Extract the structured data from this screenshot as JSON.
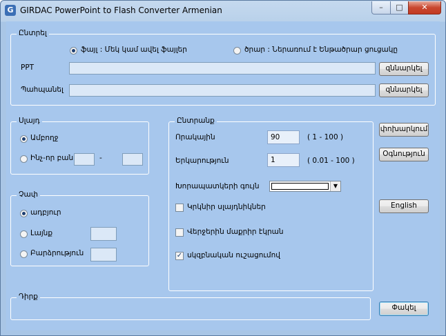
{
  "window": {
    "title": "GIRDAC PowerPoint to Flash Converter Armenian",
    "icon": "app-logo-icon",
    "controls": {
      "minimize": "–",
      "maximize": "□",
      "close": "✕"
    }
  },
  "select_group": {
    "label": "Ընտրել",
    "radio_file": "ֆայլ :  Մեկ կամ ավել ֆայլեր",
    "radio_folder": "ծրար :  Ներառում է  Ենթածրար ցուցակը",
    "ppt_label": "PPT",
    "ppt_value": "",
    "ppt_browse": "զննարկել",
    "output_label": "Պահպանել",
    "output_value": "",
    "output_browse": "զննարկել"
  },
  "slide_group": {
    "label": "Սլայդ",
    "radio_all": "Ամբողջ",
    "radio_range": "Ինչ-որ բան",
    "range_from": "",
    "range_sep": "-",
    "range_to": ""
  },
  "size_group": {
    "label": "Չափ",
    "radio_original": "ադբյուր",
    "radio_width": "Լայնք",
    "width_value": "",
    "radio_height": "Բարձրություն",
    "height_value": ""
  },
  "options_group": {
    "label": "Ընտրանք",
    "quality_label": "Որակային",
    "quality_value": "90",
    "quality_range": "( 1 - 100 )",
    "duration_label": "Երկարություն",
    "duration_value": "1",
    "duration_range": "( 0.01 - 100 )",
    "bgcolor_label": "Խորապատկերի գույն",
    "bgcolor_value": "#ffffff",
    "loop_label": "Կրկնիր սլայդնիկներ",
    "loop_checked": false,
    "endblank_label": "Վերջերին մաքրիր էկրան",
    "endblank_checked": false,
    "autostart_label": "սկզբնական ուշացումով",
    "autostart_checked": true
  },
  "side_buttons": {
    "convert": "փոխարկում",
    "help": "Օգնություն",
    "english": "English"
  },
  "status_group": {
    "label": "Դիրք",
    "value": ""
  },
  "close_button": "Փակել"
}
